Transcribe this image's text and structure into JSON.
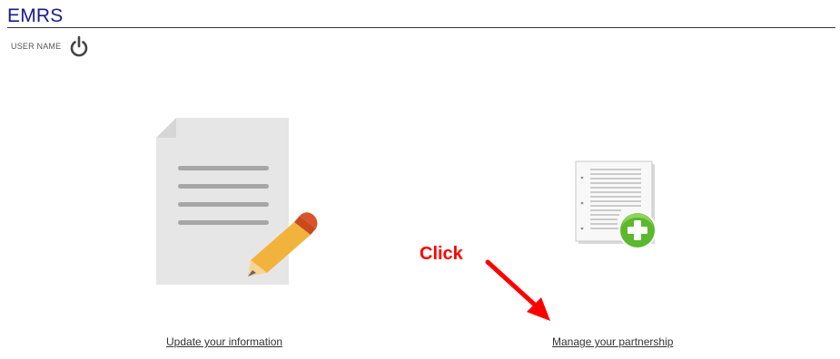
{
  "header": {
    "app_title": "EMRS",
    "user_name": "USER NAME"
  },
  "tiles": [
    {
      "label": "Update your information",
      "icon": "document-pencil-icon"
    },
    {
      "label": "Manage your partnership",
      "icon": "document-add-icon"
    }
  ],
  "annotation": {
    "text": "Click",
    "color": "#ff0000"
  },
  "colors": {
    "title": "#1a1a8c",
    "add_badge": "#5cb82e",
    "pencil": "#f2b33d",
    "eraser": "#d9532b"
  }
}
